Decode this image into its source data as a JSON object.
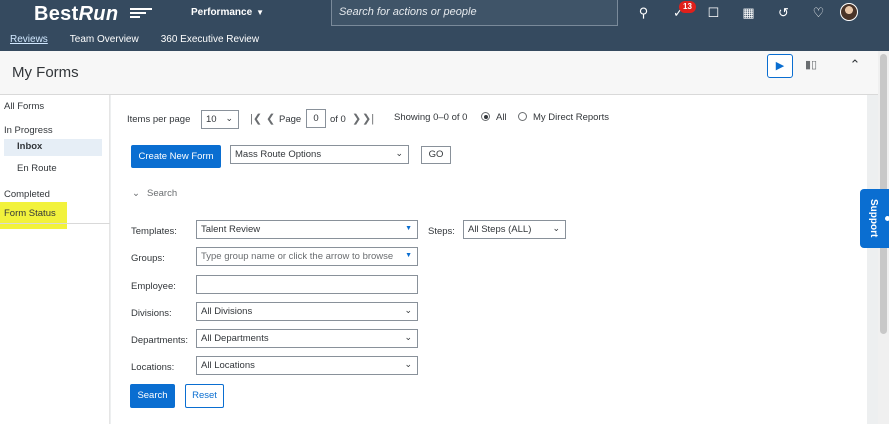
{
  "shell": {
    "logo_best": "Best",
    "logo_run": "Run",
    "module": "Performance",
    "search_placeholder": "Search for actions or people",
    "notifications_badge": "13",
    "icons": [
      "search-icon",
      "todo-icon",
      "feedback-icon",
      "org-chart-icon",
      "help-icon",
      "notification-bell-icon",
      "avatar"
    ]
  },
  "subnav": [
    "Reviews",
    "Team Overview",
    "360 Executive Review"
  ],
  "page": {
    "title": "My Forms"
  },
  "leftnav": {
    "all_forms": "All Forms",
    "in_progress": "In Progress",
    "inbox": "Inbox",
    "en_route": "En Route",
    "completed": "Completed",
    "form_status": "Form Status"
  },
  "pager": {
    "items_per_page_label": "Items per page",
    "items_per_page_value": "10",
    "page_label": "Page",
    "page_value": "0",
    "of_label": "of 0",
    "showing": "Showing 0–0 of 0",
    "radio_all": "All",
    "radio_direct": "My Direct Reports"
  },
  "actions": {
    "create_new_form": "Create New Form",
    "mass_route_options": "Mass Route Options",
    "go": "GO"
  },
  "search": {
    "toggle_label": "Search",
    "templates_label": "Templates:",
    "templates_value": "Talent Review",
    "steps_label": "Steps:",
    "steps_value": "All Steps (ALL)",
    "groups_label": "Groups:",
    "groups_placeholder": "Type group name or click the arrow to browse",
    "employee_label": "Employee:",
    "employee_value": "",
    "divisions_label": "Divisions:",
    "divisions_value": "All Divisions",
    "departments_label": "Departments:",
    "departments_value": "All Departments",
    "locations_label": "Locations:",
    "locations_value": "All Locations",
    "search_button": "Search",
    "reset_button": "Reset"
  },
  "support_tab": "Support",
  "colors": {
    "shell_bg": "#354a5f",
    "primary": "#0a6ed1",
    "highlight": "#f2f23c",
    "badge": "#e0201b"
  }
}
